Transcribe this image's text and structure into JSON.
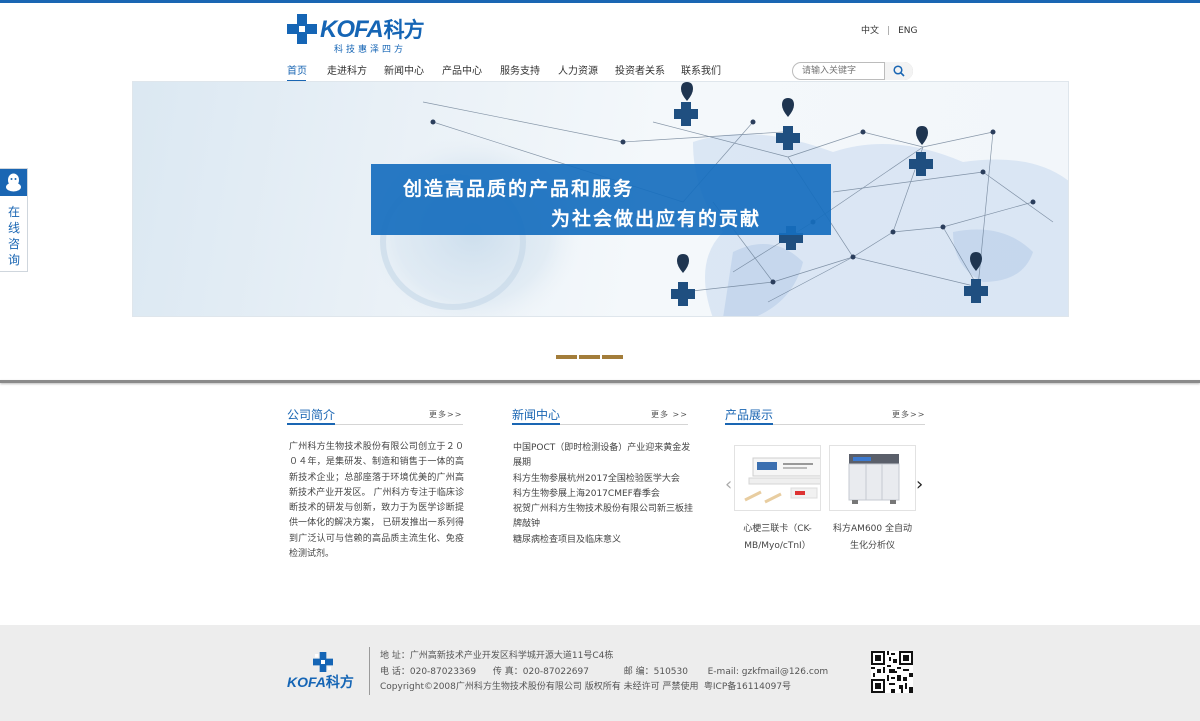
{
  "header": {
    "logo": {
      "brand": "KOFA",
      "brand_cn": "科方",
      "slogan": "科技惠泽四方"
    },
    "lang": {
      "zh": "中文",
      "separator": "|",
      "en": "ENG"
    },
    "nav": [
      {
        "label": "首页",
        "active": true
      },
      {
        "label": "走进科方"
      },
      {
        "label": "新闻中心"
      },
      {
        "label": "产品中心"
      },
      {
        "label": "服务支持"
      },
      {
        "label": "人力资源"
      },
      {
        "label": "投资者关系"
      },
      {
        "label": "联系我们"
      }
    ],
    "search": {
      "placeholder": "请输入关键字",
      "icon": "search-icon"
    }
  },
  "banner": {
    "line1": "创造高品质的产品和服务",
    "line2": "为社会做出应有的贡献",
    "slides": 3
  },
  "side_widget": {
    "icon": "qq-icon",
    "label": "在线咨询"
  },
  "sections": {
    "about": {
      "title": "公司简介",
      "more": "更多>>",
      "text": "广州科方生物技术股份有限公司创立于２０ ０４年，是集研发、制造和销售于一体的高新技术企业；总部座落于环境优美的广州高新技术产业开发区。 广州科方专注于临床诊断技术的研发与创新，致力于为医学诊断提供一体化的解决方案， 已研发推出一系列得到广泛认可与信赖的高品质主流生化、免疫检测试剂。"
    },
    "news": {
      "title": "新闻中心",
      "more": "更多 >>",
      "items": [
        "中国POCT（即时检测设备）产业迎来黄金发展期",
        "科方生物参展杭州2017全国检验医学大会",
        "科方生物参展上海2017CMEF春季会",
        "祝贺广州科方生物技术股份有限公司新三板挂牌敲钟",
        "糖尿病检查项目及临床意义"
      ]
    },
    "products": {
      "title": "产品展示",
      "more": "更多>>",
      "items": [
        {
          "name": "心梗三联卡（CK-MB/Myo/cTnI）"
        },
        {
          "name": "科方AM600 全自动生化分析仪"
        }
      ]
    }
  },
  "footer": {
    "logo": {
      "brand": "KOFA",
      "brand_cn": "科方"
    },
    "address": "地  址：广州高新技术产业开发区科学城开源大道11号C4栋",
    "phone": "电  话：020-87023369",
    "fax": "传  真：020-87022697",
    "zip": "邮  编：510530",
    "email": "E-mail: gzkfmail@126.com",
    "copyright": "Copyright©2008广州科方生物技术股份有限公司 版权所有 未经许可 严禁使用",
    "icp": "粤ICP备16114097号"
  },
  "colors": {
    "primary": "#1a66b3",
    "slide_dot": "#a37d3a",
    "footer_bg": "#ededed"
  }
}
